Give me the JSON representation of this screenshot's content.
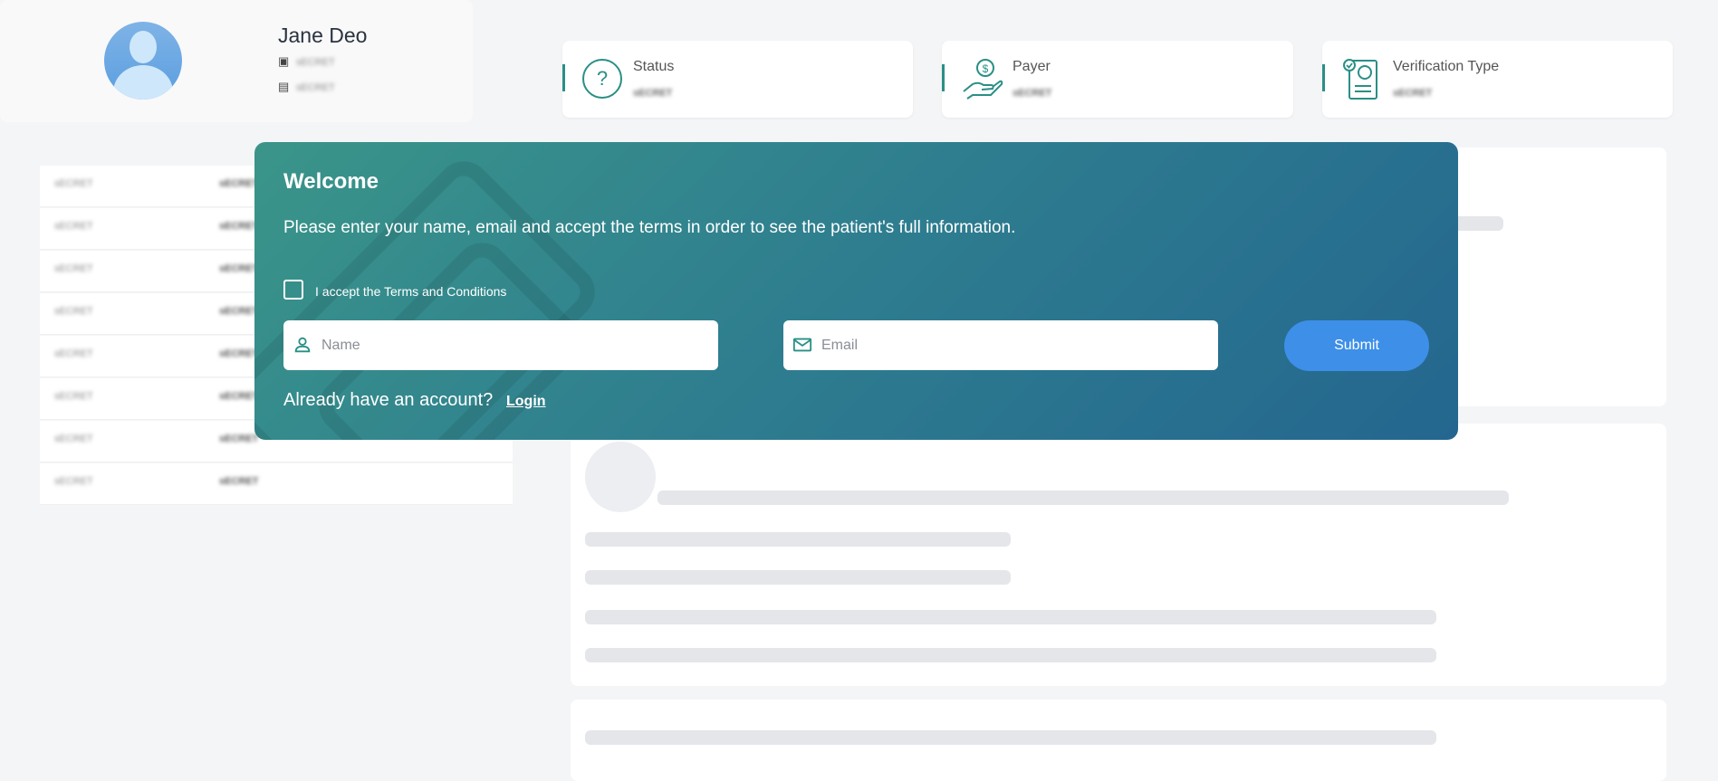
{
  "profile": {
    "name": "Jane Deo",
    "line1": "sECRET",
    "line2": "sECRET",
    "rows": [
      {
        "key": "sECRET",
        "value": "sECRET"
      },
      {
        "key": "sECRET",
        "value": "sECRET"
      },
      {
        "key": "sECRET",
        "value": "sECRET"
      },
      {
        "key": "sECRET",
        "value": "sECRET"
      },
      {
        "key": "sECRET",
        "value": "sECRET"
      },
      {
        "key": "sECRET",
        "value": "sECRET"
      },
      {
        "key": "sECRET",
        "value": "sECRET"
      },
      {
        "key": "sECRET",
        "value": "sECRET"
      }
    ]
  },
  "summary": [
    {
      "title": "Status",
      "value": "sECRET",
      "icon": "question-circle-icon"
    },
    {
      "title": "Payer",
      "value": "sECRET",
      "icon": "hand-dollar-icon"
    },
    {
      "title": "Verification Type",
      "value": "sECRET",
      "icon": "verified-document-icon"
    }
  ],
  "modal": {
    "title": "Welcome",
    "subtitle": "Please enter your name, email and accept the terms in order to see the patient's full information.",
    "terms_label": "I accept the Terms and Conditions",
    "name_placeholder": "Name",
    "email_placeholder": "Email",
    "submit_label": "Submit",
    "account_text": "Already have an account?",
    "login_label": "Login"
  },
  "colors": {
    "accent": "#2a8f86",
    "modal_start": "#3a9589",
    "modal_end": "#24668f",
    "submit": "#3d8fe8"
  }
}
